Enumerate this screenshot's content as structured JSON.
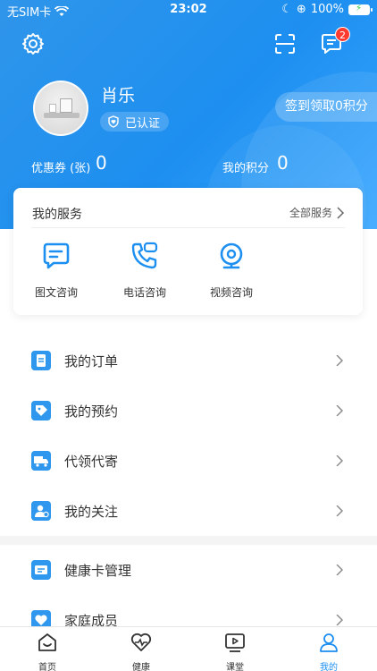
{
  "status": {
    "carrier": "无SIM卡",
    "time": "23:02",
    "battery": "100%"
  },
  "header": {
    "username": "肖乐",
    "verified_label": "已认证",
    "checkin_label": "签到领取0积分",
    "message_badge": "2",
    "coupon_label": "优惠券 (张)",
    "coupon_value": "0",
    "points_label": "我的积分",
    "points_value": "0"
  },
  "services": {
    "title": "我的服务",
    "more": "全部服务",
    "items": [
      {
        "label": "图文咨询",
        "icon": "chat-text-icon"
      },
      {
        "label": "电话咨询",
        "icon": "phone-icon"
      },
      {
        "label": "视频咨询",
        "icon": "video-camera-icon"
      }
    ]
  },
  "menu": [
    {
      "label": "我的订单",
      "icon": "order-icon"
    },
    {
      "label": "我的预约",
      "icon": "appointment-icon"
    },
    {
      "label": "代领代寄",
      "icon": "delivery-truck-icon"
    },
    {
      "label": "我的关注",
      "icon": "follow-icon"
    },
    {
      "label": "健康卡管理",
      "icon": "health-card-icon"
    },
    {
      "label": "家庭成员",
      "icon": "family-icon"
    }
  ],
  "tabs": [
    {
      "label": "首页",
      "icon": "home-icon"
    },
    {
      "label": "健康",
      "icon": "health-icon"
    },
    {
      "label": "课堂",
      "icon": "classroom-icon"
    },
    {
      "label": "我的",
      "icon": "profile-icon",
      "active": true
    }
  ],
  "colors": {
    "primary": "#1d8ff0",
    "badge": "#ff3b30"
  }
}
